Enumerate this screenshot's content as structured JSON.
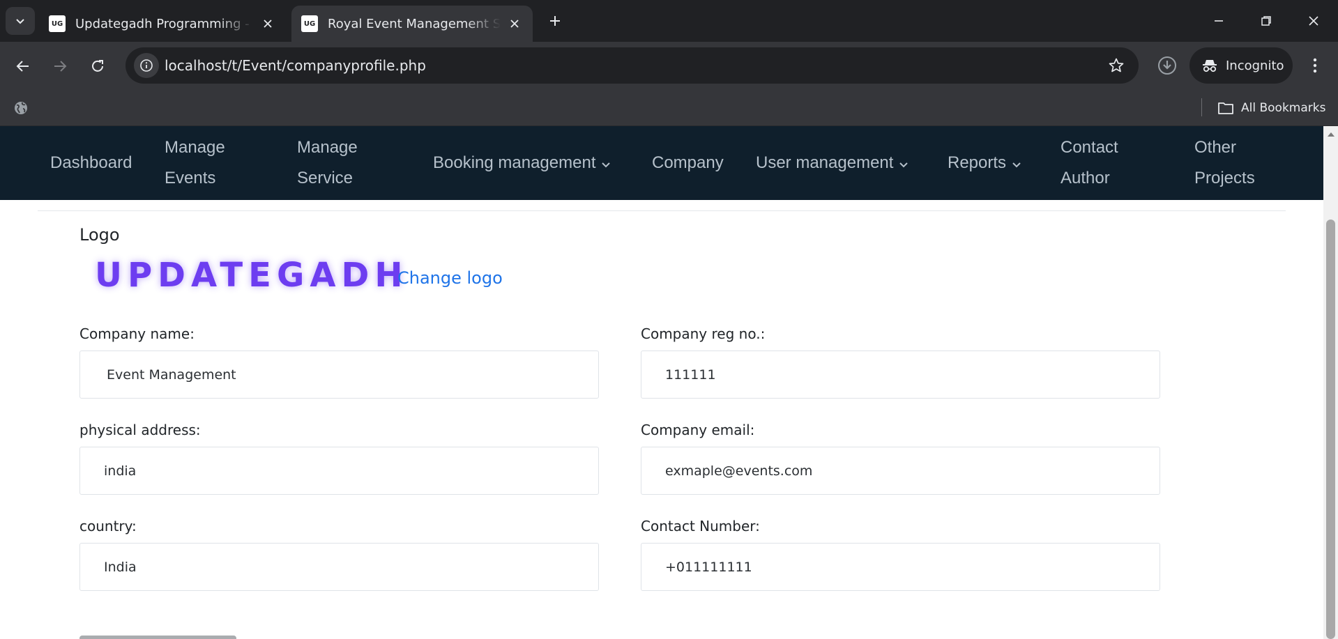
{
  "browser": {
    "tabs": [
      {
        "title": "Updategadh Programming - Up",
        "favicon_text": "UG",
        "active": false
      },
      {
        "title": "Royal Event Management Softw",
        "favicon_text": "UG",
        "active": true
      }
    ],
    "url": "localhost/t/Event/companyprofile.php",
    "incognito_label": "Incognito",
    "bookmarks_label": "All Bookmarks"
  },
  "nav": {
    "dashboard": "Dashboard",
    "manage_events_1": "Manage",
    "manage_events_2": "Events",
    "manage_service_1": "Manage",
    "manage_service_2": "Service",
    "booking_management": "Booking management",
    "company": "Company",
    "user_management": "User management",
    "reports": "Reports",
    "contact_author_1": "Contact",
    "contact_author_2": "Author",
    "other_projects_1": "Other",
    "other_projects_2": "Projects"
  },
  "logo": {
    "label": "Logo",
    "wordmark": "UPDATEGADH",
    "change_link": "Change logo"
  },
  "form": {
    "company_name": {
      "label": "Company name:",
      "value": "Event Management"
    },
    "company_reg": {
      "label": "Company reg no.:",
      "value": "111111"
    },
    "physical_address": {
      "label": "physical address:",
      "value": "india"
    },
    "company_email": {
      "label": "Company email:",
      "value": "exmaple@events.com"
    },
    "country": {
      "label": "country:",
      "value": "India"
    },
    "contact_number": {
      "label": "Contact Number:",
      "value": "+011111111"
    }
  },
  "colors": {
    "navbar_bg": "#0f1f2c",
    "nav_text": "#b6c1cb",
    "logo_purple": "#6d3df0",
    "link_blue": "#1f74e8"
  }
}
